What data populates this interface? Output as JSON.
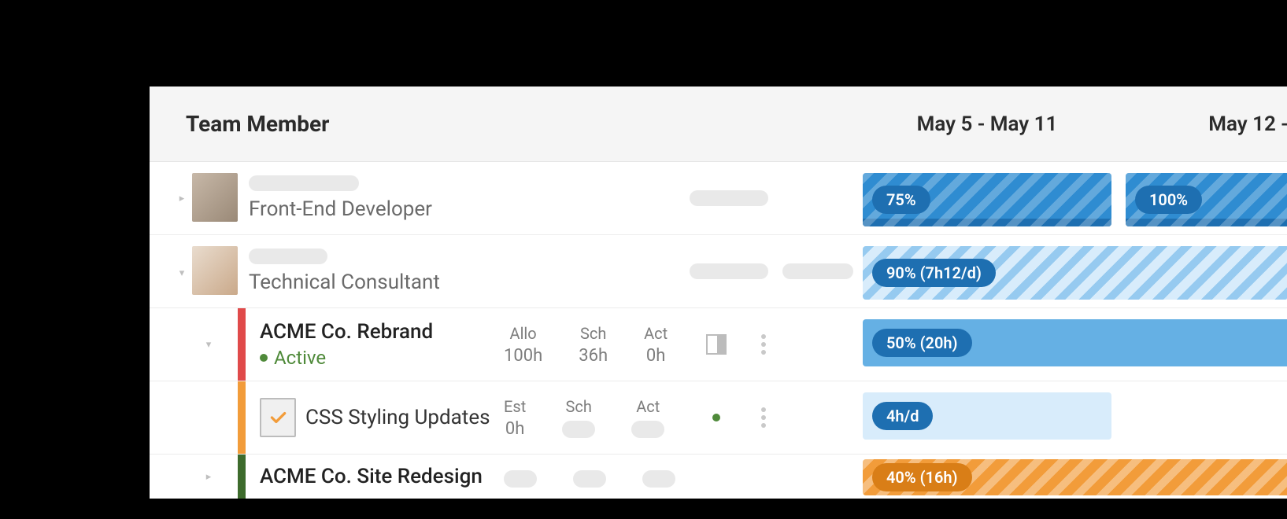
{
  "header": {
    "title": "Team Member",
    "weeks": [
      "May 5 - May 11",
      "May 12 - "
    ]
  },
  "members": [
    {
      "role": "Front-End Developer",
      "cells": [
        {
          "label": "75%",
          "style": "stripes-blue-dark",
          "underbar": true
        },
        {
          "label": "100%",
          "style": "stripes-blue-dark",
          "underbar": true
        }
      ]
    },
    {
      "role": "Technical Consultant",
      "cells": [
        {
          "label": "90% (7h12/d)",
          "style": "stripes-blue-light"
        }
      ],
      "projects": [
        {
          "color": "red",
          "name": "ACME Co. Rebrand",
          "status": "Active",
          "stats": {
            "allo_lbl": "Allo",
            "allo": "100h",
            "sch_lbl": "Sch",
            "sch": "36h",
            "act_lbl": "Act",
            "act": "0h"
          },
          "cells": [
            {
              "label": "50% (20h)",
              "style": "solid-blue"
            }
          ]
        },
        {
          "color": "orange",
          "name": "CSS Styling Updates",
          "is_task": true,
          "stats": {
            "est_lbl": "Est",
            "est": "0h",
            "sch_lbl": "Sch",
            "act_lbl": "Act"
          },
          "cells": [
            {
              "label": "4h/d",
              "style": "solid-blue-lightest"
            }
          ]
        },
        {
          "color": "green",
          "name": "ACME Co. Site Redesign",
          "cells": [
            {
              "label": "40% (16h)",
              "style": "stripes-orange",
              "pill_class": "pill-orange"
            }
          ]
        }
      ]
    }
  ]
}
